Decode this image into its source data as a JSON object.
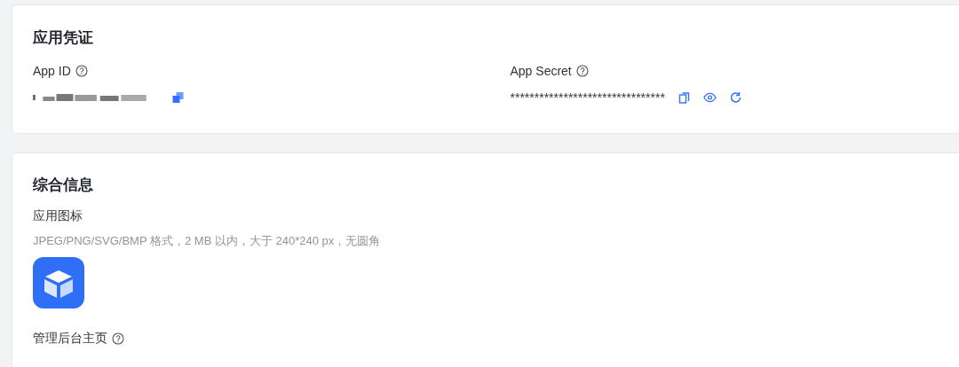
{
  "credentials": {
    "title": "应用凭证",
    "app_id": {
      "label": "App ID"
    },
    "app_secret": {
      "label": "App Secret",
      "value": "********************************"
    }
  },
  "general": {
    "title": "综合信息",
    "icon_field": {
      "label": "应用图标",
      "hint": "JPEG/PNG/SVG/BMP 格式，2 MB 以内，大于 240*240 px，无圆角"
    },
    "homepage_field": {
      "label": "管理后台主页"
    }
  }
}
